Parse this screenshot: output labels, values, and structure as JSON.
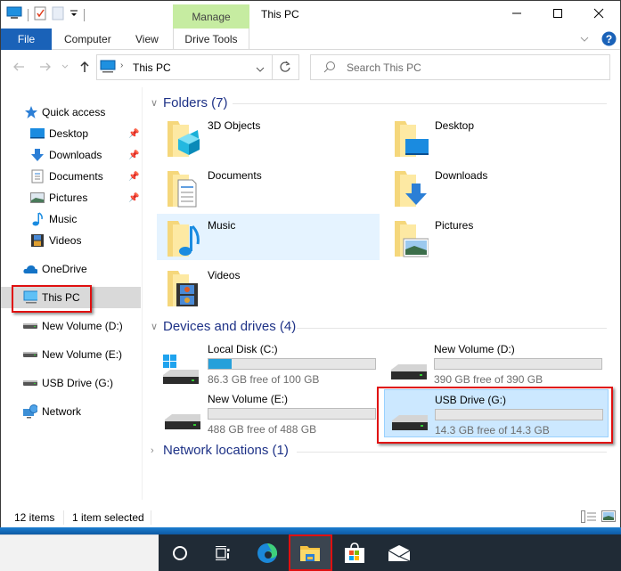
{
  "window": {
    "title": "This PC",
    "manage_tab": "Manage",
    "controls": {
      "minimize": "minimize-icon",
      "maximize": "maximize-icon",
      "close": "close-icon"
    }
  },
  "ribbon": {
    "tabs": [
      {
        "label": "File"
      },
      {
        "label": "Computer"
      },
      {
        "label": "View"
      },
      {
        "label": "Drive Tools"
      }
    ]
  },
  "nav": {
    "address_path": "This PC",
    "search_placeholder": "Search This PC"
  },
  "sidebar": {
    "items": [
      {
        "label": "Quick access",
        "icon": "star-icon"
      },
      {
        "label": "Desktop",
        "icon": "desktop-icon",
        "pinned": true
      },
      {
        "label": "Downloads",
        "icon": "download-icon",
        "pinned": true
      },
      {
        "label": "Documents",
        "icon": "document-icon",
        "pinned": true
      },
      {
        "label": "Pictures",
        "icon": "pictures-icon",
        "pinned": true
      },
      {
        "label": "Music",
        "icon": "music-icon"
      },
      {
        "label": "Videos",
        "icon": "videos-icon"
      },
      {
        "label": "OneDrive",
        "icon": "cloud-icon"
      },
      {
        "label": "This PC",
        "icon": "computer-icon",
        "selected": true
      },
      {
        "label": "New Volume (D:)",
        "icon": "drive-icon"
      },
      {
        "label": "New Volume (E:)",
        "icon": "drive-icon"
      },
      {
        "label": "USB Drive (G:)",
        "icon": "drive-icon"
      },
      {
        "label": "Network",
        "icon": "network-icon"
      }
    ]
  },
  "main": {
    "folders_header": "Folders (7)",
    "folders": [
      {
        "name": "3D Objects",
        "overlay": "cube-icon"
      },
      {
        "name": "Desktop",
        "overlay": "desktop-icon"
      },
      {
        "name": "Documents",
        "overlay": "document-icon"
      },
      {
        "name": "Downloads",
        "overlay": "download-icon"
      },
      {
        "name": "Music",
        "overlay": "music-icon",
        "selected": true
      },
      {
        "name": "Pictures",
        "overlay": "pictures-icon"
      },
      {
        "name": "Videos",
        "overlay": "videos-icon"
      }
    ],
    "drives_header": "Devices and drives (4)",
    "drives": [
      {
        "name": "Local Disk (C:)",
        "free_text": "86.3 GB free of 100 GB",
        "used_fraction": 0.137,
        "windows": true
      },
      {
        "name": "New Volume (D:)",
        "free_text": "390 GB free of 390 GB",
        "used_fraction": 0
      },
      {
        "name": "New Volume (E:)",
        "free_text": "488 GB free of 488 GB",
        "used_fraction": 0
      },
      {
        "name": "USB Drive (G:)",
        "free_text": "14.3 GB free of 14.3 GB",
        "used_fraction": 0,
        "selected": true
      }
    ],
    "network_header": "Network locations (1)"
  },
  "status": {
    "item_count": "12 items",
    "selection": "1 item selected"
  },
  "colors": {
    "accent": "#1a62b8",
    "manage_tab": "#c6eca1",
    "group_header": "#1e3287",
    "storage_bar": "#26a0da",
    "highlight_box": "#e01010",
    "taskbar": "#202b36"
  },
  "taskbar": {
    "items": [
      {
        "icon": "cortana-icon"
      },
      {
        "icon": "task-view-icon"
      },
      {
        "icon": "edge-icon"
      },
      {
        "icon": "file-explorer-icon",
        "active": true
      },
      {
        "icon": "store-icon"
      },
      {
        "icon": "mail-icon"
      }
    ]
  }
}
